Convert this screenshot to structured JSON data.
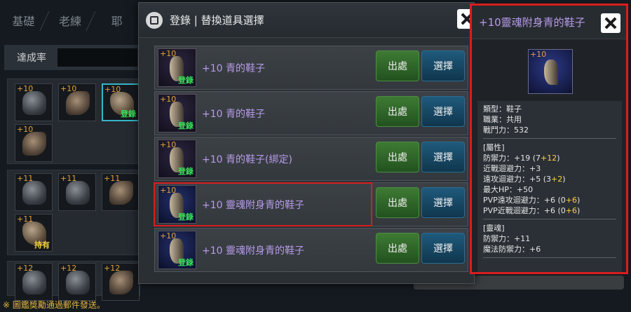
{
  "background": {
    "tabs": [
      "基礎",
      "老練",
      "耶"
    ],
    "rate_label": "達成率",
    "footer_note": "※ 圖鑑獎勵通過郵件發送。",
    "slots_group1": [
      {
        "lv": "+10",
        "kind": "helmet",
        "tag": ""
      },
      {
        "lv": "+10",
        "kind": "glove",
        "tag": ""
      },
      {
        "lv": "+10",
        "kind": "boot",
        "tag": "登錄",
        "tag_color": "green",
        "selected": true
      },
      {
        "lv": "+10",
        "kind": "belt",
        "tag": ""
      }
    ],
    "slots_group2": [
      {
        "lv": "+11",
        "kind": "helmet",
        "tag": ""
      },
      {
        "lv": "+11",
        "kind": "armor",
        "tag": ""
      },
      {
        "lv": "+11",
        "kind": "glove",
        "tag": ""
      },
      {
        "lv": "+11",
        "kind": "boot",
        "tag": "持有",
        "tag_color": "yellow"
      }
    ],
    "slots_group3": [
      {
        "lv": "+12",
        "kind": "helmet",
        "tag": ""
      },
      {
        "lv": "+12",
        "kind": "armor",
        "tag": ""
      },
      {
        "lv": "+12",
        "kind": "glove",
        "tag": ""
      }
    ]
  },
  "dialog": {
    "title": "登錄 | 替換道具選擇",
    "items": [
      {
        "lv": "+10",
        "tag": "登錄",
        "name": "+10 青的鞋子",
        "soul": false,
        "highlighted": false
      },
      {
        "lv": "+10",
        "tag": "登錄",
        "name": "+10 青的鞋子",
        "soul": false,
        "highlighted": false
      },
      {
        "lv": "+10",
        "tag": "登錄",
        "name": "+10 青的鞋子(綁定)",
        "soul": false,
        "highlighted": false
      },
      {
        "lv": "+10",
        "tag": "登錄",
        "name": "+10 靈魂附身青的鞋子",
        "soul": true,
        "highlighted": true
      },
      {
        "lv": "+10",
        "tag": "登錄",
        "name": "+10 靈魂附身青的鞋子",
        "soul": true,
        "highlighted": false
      }
    ],
    "source_label": "出處",
    "select_label": "選擇"
  },
  "detail": {
    "title": "+10靈魂附身青的鞋子",
    "icon_lv": "+10",
    "basic": [
      "類型：鞋子",
      "職業：共用",
      "戰鬥力：532"
    ],
    "attr_header": "[屬性]",
    "attrs": [
      {
        "text": "防禦力：+19 (7",
        "bonus": "+12",
        "close": ")"
      },
      {
        "text": "近戰迴避力：+3",
        "bonus": "",
        "close": ""
      },
      {
        "text": "遠攻迴避力：+5 (3",
        "bonus": "+2",
        "close": ")"
      },
      {
        "text": "最大HP：+50",
        "bonus": "",
        "close": ""
      },
      {
        "text": "PVP遠攻迴避力：+6 (0",
        "bonus": "+6",
        "close": ")"
      },
      {
        "text": "PVP近戰迴避力：+6 (0",
        "bonus": "+6",
        "close": ")"
      }
    ],
    "soul_header": "[靈魂]",
    "soul": [
      "防禦力：+11",
      "魔法防禦力：+6"
    ]
  },
  "colors": {
    "highlight_red": "#d81e1e",
    "item_name": "#b79be8",
    "level_orange": "#e1a13b",
    "registered_green": "#36e05a",
    "bonus_yellow": "#ffd23a"
  },
  "icons": {
    "dialog": "book-icon",
    "close": "close-icon"
  }
}
